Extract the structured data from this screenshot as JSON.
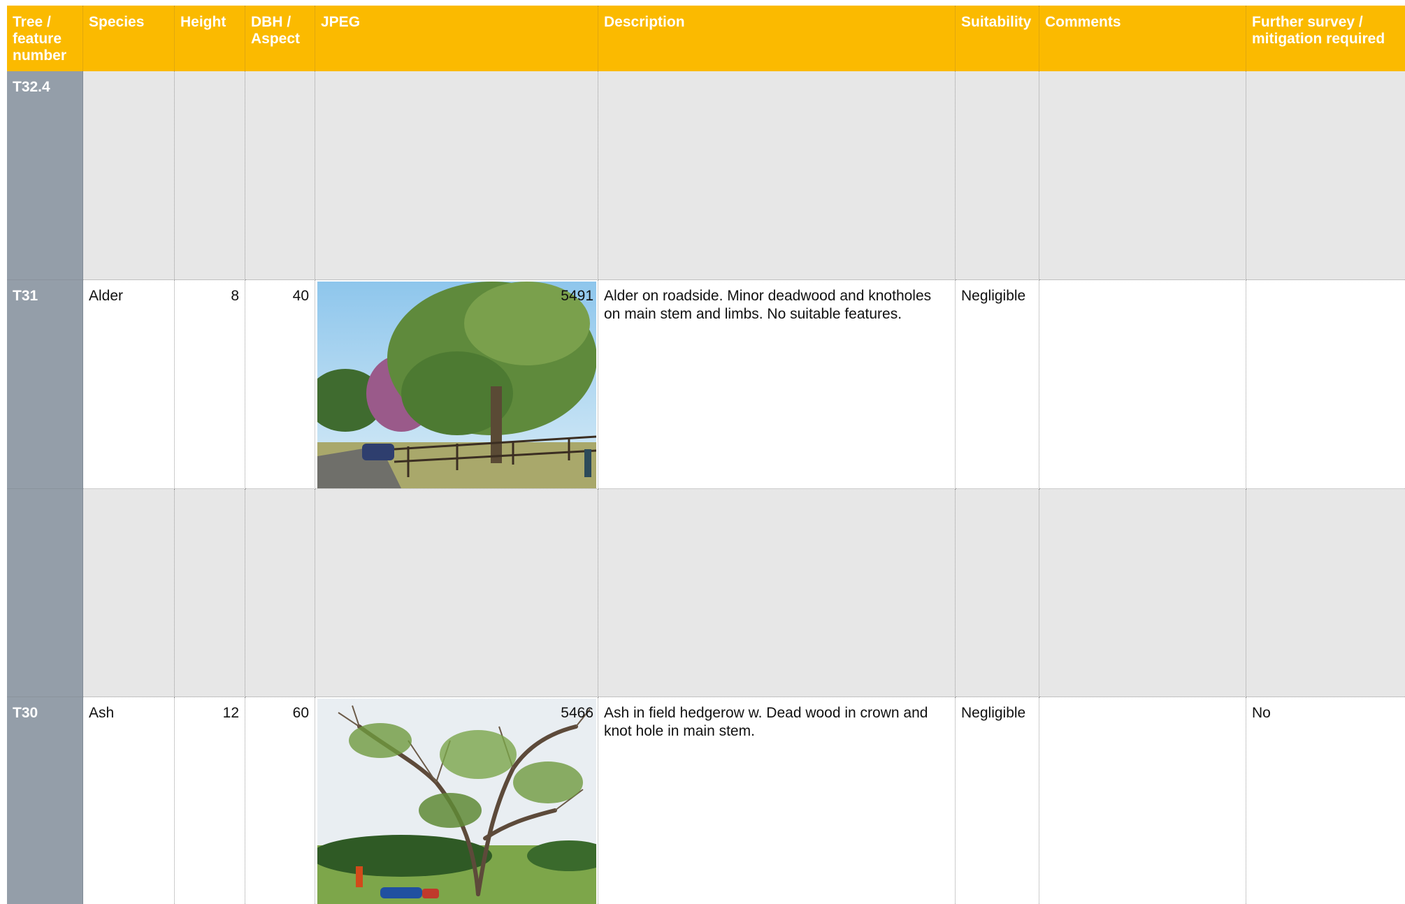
{
  "table": {
    "headers": [
      "Tree / feature number",
      "Species",
      "Height",
      "DBH / Aspect",
      "JPEG",
      "Description",
      "Suitability",
      "Comments",
      "Further survey / mitigation required"
    ],
    "rows": [
      {
        "id": "T32.4",
        "species": "",
        "height": "",
        "dbh": "",
        "photo_ref": "",
        "description": "",
        "suitability": "",
        "comments": "",
        "further": ""
      },
      {
        "id": "T31",
        "species": "Alder",
        "height": "8",
        "dbh": "40",
        "photo_ref": "5491",
        "description": "Alder on roadside. Minor deadwood and knotholes on main stem and limbs. No suitable features.",
        "suitability": "Negligible",
        "comments": "",
        "further": ""
      },
      {
        "id": "",
        "species": "",
        "height": "",
        "dbh": "",
        "photo_ref": "",
        "description": "",
        "suitability": "",
        "comments": "",
        "further": ""
      },
      {
        "id": "T30",
        "species": "Ash",
        "height": "12",
        "dbh": "60",
        "photo_ref": "5466",
        "description": "Ash in field hedgerow w. Dead wood in crown and knot hole in main stem.",
        "suitability": "Negligible",
        "comments": "",
        "further": "No"
      }
    ]
  },
  "colors": {
    "header_bg": "#fbba00",
    "id_column_bg": "#949ea9",
    "shaded_row_bg": "#e7e7e7"
  }
}
